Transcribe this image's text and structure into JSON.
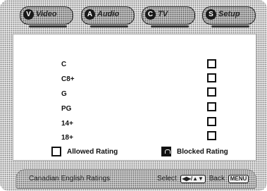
{
  "tabs": [
    {
      "icon": "V",
      "label": "Video"
    },
    {
      "icon": "A",
      "label": "Audio"
    },
    {
      "icon": "C",
      "label": "TV"
    },
    {
      "icon": "S",
      "label": "Setup"
    }
  ],
  "ratings": [
    {
      "label": "C",
      "blocked": false
    },
    {
      "label": "C8+",
      "blocked": false
    },
    {
      "label": "G",
      "blocked": false
    },
    {
      "label": "PG",
      "blocked": false
    },
    {
      "label": "14+",
      "blocked": false
    },
    {
      "label": "18+",
      "blocked": false
    }
  ],
  "legend": {
    "allowed": "Allowed Rating",
    "blocked": "Blocked Rating"
  },
  "bottom": {
    "title": "Canadian English Ratings",
    "select": "Select",
    "select_key": "◀▶/▲▼",
    "back": "Back",
    "back_key": "MENU"
  }
}
